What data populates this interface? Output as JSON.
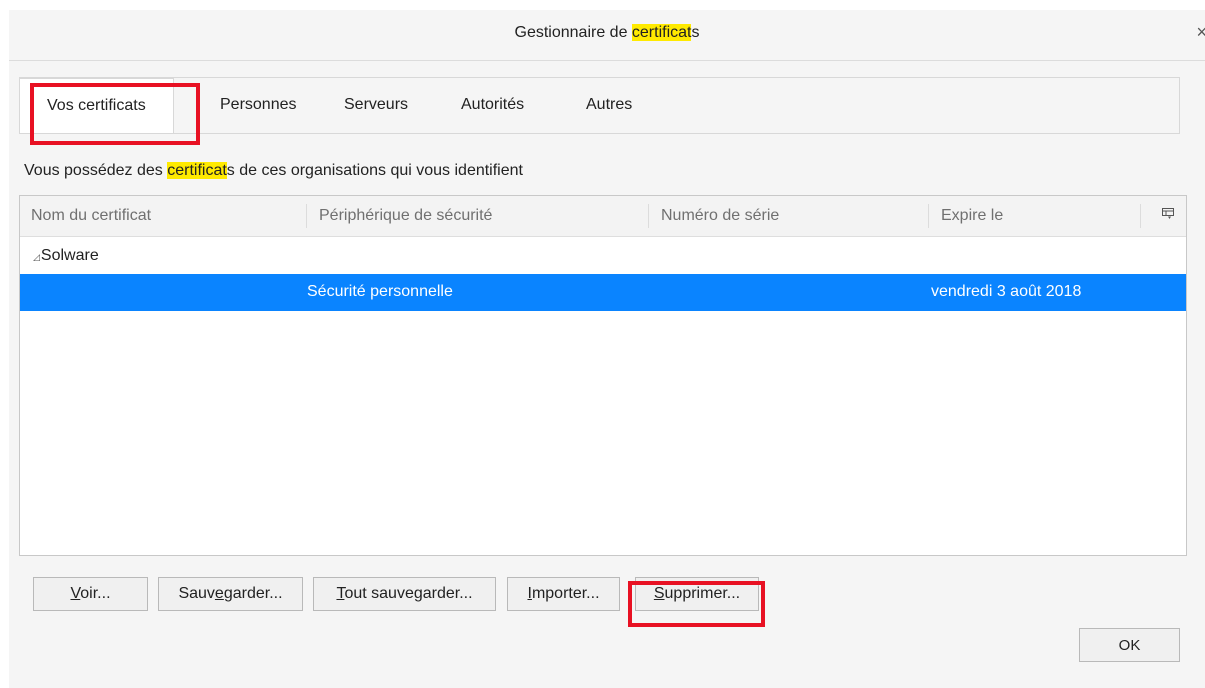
{
  "dialog": {
    "title_prefix": "Gestionnaire de ",
    "title_highlight": "certificat",
    "title_suffix": "s",
    "close_glyph": "×"
  },
  "tabs": [
    {
      "label": "Vos certificats",
      "active": true
    },
    {
      "label": "Personnes"
    },
    {
      "label": "Serveurs"
    },
    {
      "label": "Autorités"
    },
    {
      "label": "Autres"
    }
  ],
  "description": {
    "prefix": "Vous possédez des ",
    "highlight": "certificat",
    "suffix": "s de ces organisations qui vous identifient"
  },
  "table": {
    "columns": [
      "Nom du certificat",
      "Périphérique de sécurité",
      "Numéro de série",
      "Expire le"
    ],
    "picker_icon": "column-picker-icon",
    "group": {
      "twisty": "◿",
      "name": "Solware"
    },
    "rows": [
      {
        "name": "",
        "device": "Sécurité personnelle",
        "serial": "",
        "expires": "vendredi 3 août 2018",
        "selected": true
      }
    ]
  },
  "buttons": {
    "view": {
      "mnemonic": "V",
      "rest": "oir..."
    },
    "backup": {
      "pre": "Sauv",
      "mnemonic": "e",
      "post": "garder..."
    },
    "backup_all": {
      "mnemonic": "T",
      "rest": "out sauvegarder..."
    },
    "import": {
      "mnemonic": "I",
      "rest": "mporter..."
    },
    "delete": {
      "mnemonic": "S",
      "rest": "upprimer..."
    },
    "ok": "OK"
  },
  "colors": {
    "highlight": "#ffea00",
    "selection": "#0a84ff",
    "annotation": "#e81123"
  }
}
